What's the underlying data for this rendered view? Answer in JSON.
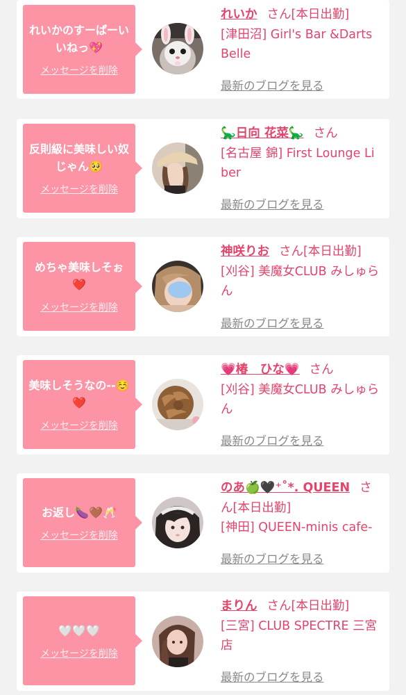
{
  "colors": {
    "bubble": "#fc94a5",
    "accent": "#e3446b",
    "muted": "#888888",
    "card": "#ffffff",
    "background": "#f2f2f2"
  },
  "cards": [
    {
      "message": "れいかのすーぱーいいねっ💖",
      "delete_label": "メッセージを削除",
      "name": "れいか",
      "honorific": "さん",
      "status": "[本日出勤]",
      "shop": "[津田沼] Girl's Bar &Darts Belle",
      "blog_label": "最新のブログを見る",
      "avatar_icon": "bunny-filter-photo"
    },
    {
      "message": "反則級に美味しい奴じゃん🥺",
      "delete_label": "メッセージを削除",
      "name": "🦕日向 花菜🦕",
      "honorific": "さん",
      "status": "",
      "shop": "[名古屋 錦] First Lounge Liber",
      "blog_label": "最新のブログを見る",
      "avatar_icon": "hat-woman-photo"
    },
    {
      "message": "めちゃ美味しそぉ❤️",
      "delete_label": "メッセージを削除",
      "name": "神咲りお",
      "honorific": "さん",
      "status": "[本日出勤]",
      "shop": "[刈谷] 美魔女CLUB みしゅらん",
      "blog_label": "最新のブログを見る",
      "avatar_icon": "blurred-face-photo"
    },
    {
      "message": "美味しそうなの--☺️❤️",
      "delete_label": "メッセージを削除",
      "name": "💗椿　ひな💗",
      "honorific": "さん",
      "status": "",
      "shop": "[刈谷] 美魔女CLUB みしゅらん",
      "blog_label": "最新のブログを見る",
      "avatar_icon": "hair-updo-photo"
    },
    {
      "message": "お返し🍆🤎🥂",
      "delete_label": "メッセージを削除",
      "name": "のあ🍏🖤⁺˚*. QUEEN",
      "honorific": "さん",
      "status": "[本日出勤]",
      "shop": "[神田] QUEEN-minis cafe-",
      "blog_label": "最新のブログを見る",
      "avatar_icon": "girl-hair-band-photo"
    },
    {
      "message": "🤍🤍🤍",
      "delete_label": "メッセージを削除",
      "name": "まりん",
      "honorific": "さん",
      "status": "[本日出勤]",
      "shop": "[三宮] CLUB SPECTRE 三宮店",
      "blog_label": "最新のブログを見る",
      "avatar_icon": "long-hair-woman-photo"
    }
  ]
}
